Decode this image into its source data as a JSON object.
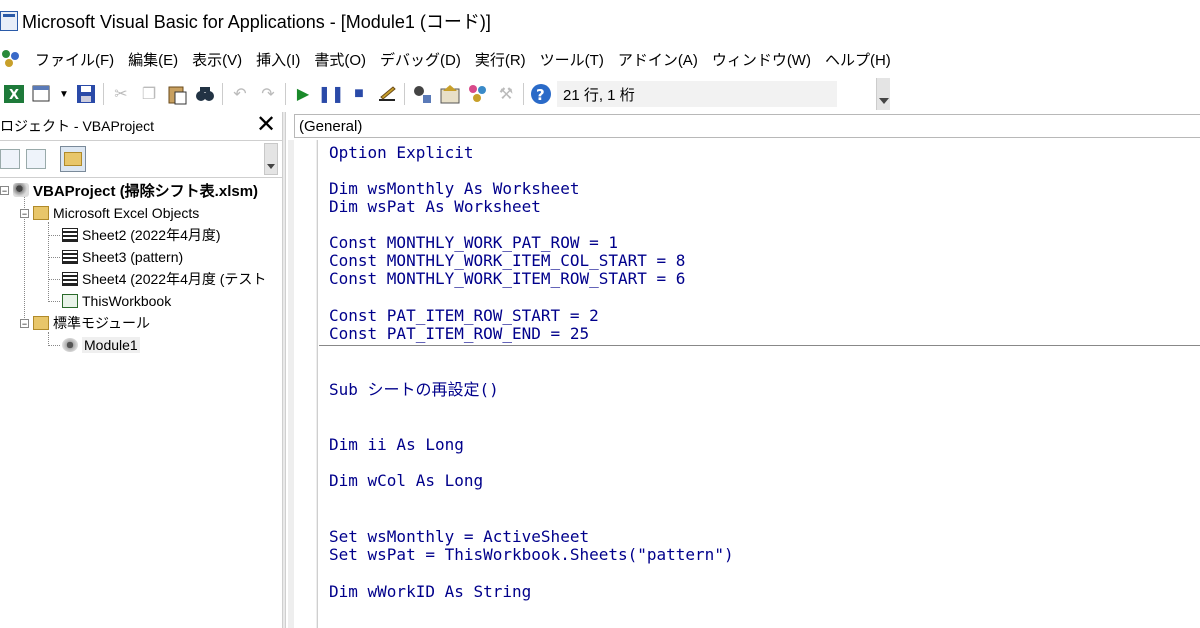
{
  "window": {
    "title": "Microsoft Visual Basic for Applications - [Module1 (コード)]"
  },
  "menu": {
    "items": [
      "ファイル(F)",
      "編集(E)",
      "表示(V)",
      "挿入(I)",
      "書式(O)",
      "デバッグ(D)",
      "実行(R)",
      "ツール(T)",
      "アドイン(A)",
      "ウィンドウ(W)",
      "ヘルプ(H)"
    ]
  },
  "toolbar": {
    "position": "21 行, 1 桁"
  },
  "project": {
    "title": "ロジェクト - VBAProject",
    "close": "✕",
    "tree": {
      "root": "VBAProject (掃除シフト表.xlsm)",
      "excel_objects": "Microsoft Excel Objects",
      "sheet2": "Sheet2 (2022年4月度)",
      "sheet3": "Sheet3 (pattern)",
      "sheet4": "Sheet4 (2022年4月度 (テスト",
      "thisworkbook": "ThisWorkbook",
      "modules_folder": "標準モジュール",
      "module1": "Module1"
    }
  },
  "code": {
    "object_combo": "(General)",
    "lines": [
      "Option Explicit",
      "Dim wsMonthly As Worksheet",
      "Dim wsPat As Worksheet",
      "Const MONTHLY_WORK_PAT_ROW = 1",
      "Const MONTHLY_WORK_ITEM_COL_START = 8",
      "Const MONTHLY_WORK_ITEM_ROW_START = 6",
      "Const PAT_ITEM_ROW_START = 2",
      "Const PAT_ITEM_ROW_END = 25",
      "Sub シートの再設定()",
      "Dim ii As Long",
      "Dim wCol As Long",
      "Set wsMonthly = ActiveSheet",
      "Set wsPat = ThisWorkbook.Sheets(\"pattern\")",
      "Dim wWorkID As String"
    ]
  }
}
